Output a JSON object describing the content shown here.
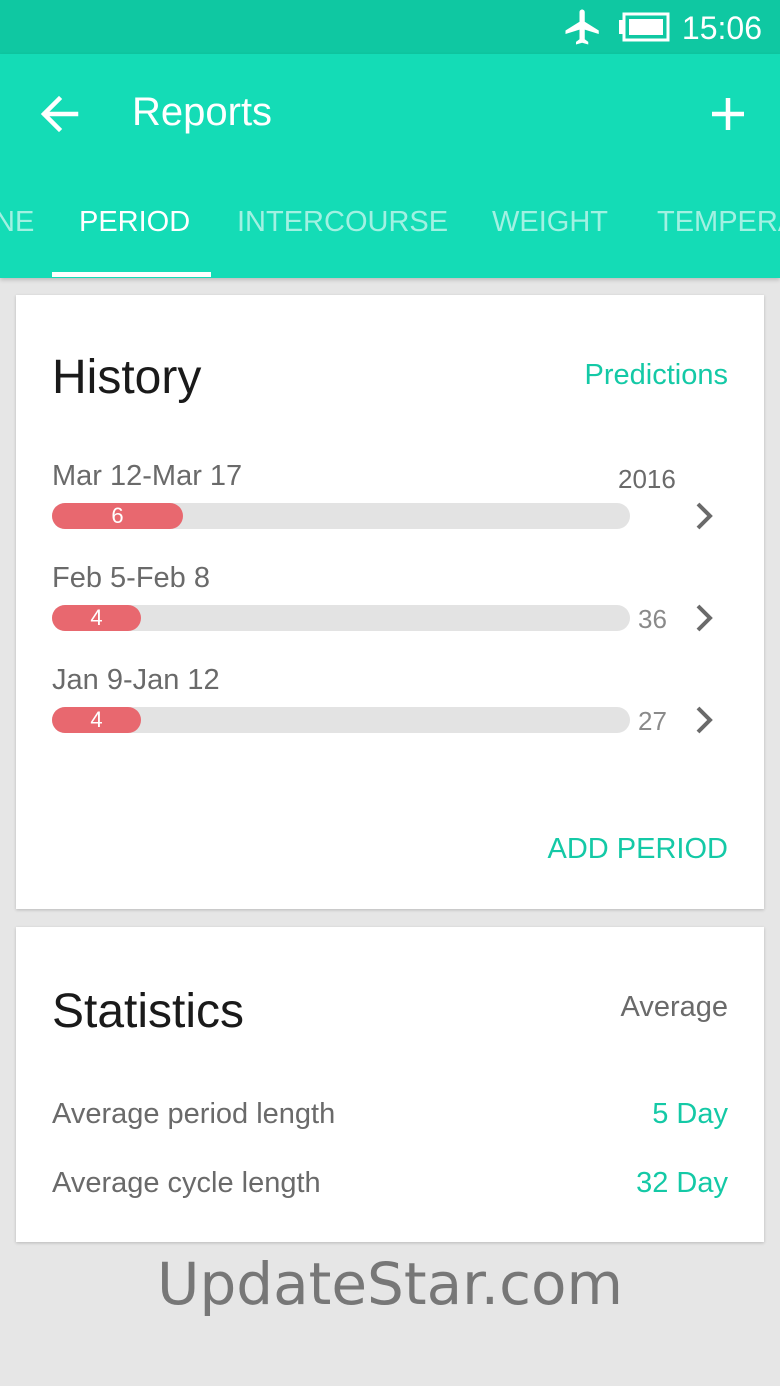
{
  "status_bar": {
    "time": "15:06"
  },
  "app_bar": {
    "title": "Reports"
  },
  "tabs": [
    {
      "label": "NE"
    },
    {
      "label": "PERIOD",
      "active": true
    },
    {
      "label": "INTERCOURSE"
    },
    {
      "label": "WEIGHT"
    },
    {
      "label": "TEMPERA"
    }
  ],
  "history": {
    "title": "History",
    "predictions_label": "Predictions",
    "rows": [
      {
        "date": "Mar 12-Mar 17",
        "year": "2016",
        "period_length": "6",
        "cycle_length": ""
      },
      {
        "date": "Feb 5-Feb 8",
        "year": "",
        "period_length": "4",
        "cycle_length": "36"
      },
      {
        "date": "Jan 9-Jan 12",
        "year": "",
        "period_length": "4",
        "cycle_length": "27"
      }
    ],
    "add_period_label": "ADD PERIOD"
  },
  "statistics": {
    "title": "Statistics",
    "mode_label": "Average",
    "items": [
      {
        "label": "Average period length",
        "value": "5 Day"
      },
      {
        "label": "Average cycle length",
        "value": "32 Day"
      }
    ]
  },
  "watermark": "UpdateStar.com",
  "colors": {
    "accent": "#14dcb6",
    "status_bar": "#0fc8a2",
    "link": "#14c9a6",
    "period_bar": "#e8686f",
    "track": "#e3e3e3"
  },
  "icons": [
    "airplane-icon",
    "battery-icon",
    "back-arrow-icon",
    "plus-icon",
    "chevron-right-icon"
  ]
}
